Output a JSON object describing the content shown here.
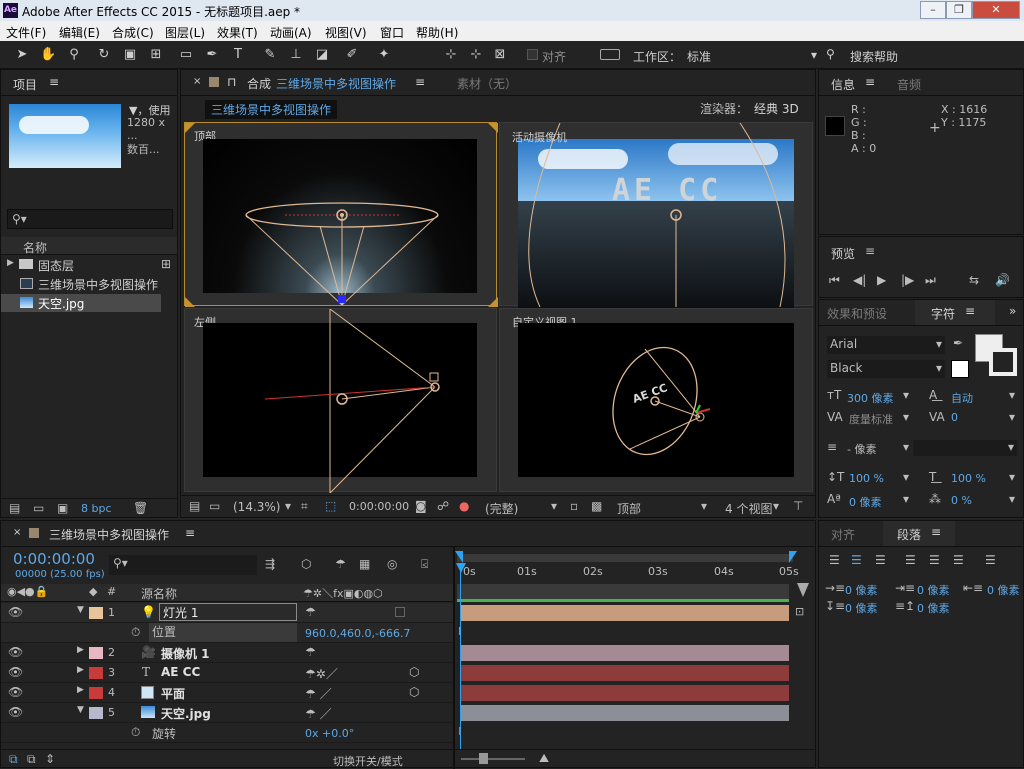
{
  "window": {
    "title": "Adobe After Effects CC 2015 - 无标题项目.aep *",
    "logo": "Ae",
    "min": "–",
    "max": "❐",
    "close": "✕"
  },
  "menu": [
    "文件(F)",
    "编辑(E)",
    "合成(C)",
    "图层(L)",
    "效果(T)",
    "动画(A)",
    "视图(V)",
    "窗口",
    "帮助(H)"
  ],
  "toolbar": {
    "align_label": "对齐",
    "workspace_label": "工作区：",
    "workspace_value": "标准",
    "search_help": "搜索帮助"
  },
  "project": {
    "tab": "项目",
    "footage_name": "▼，使用",
    "footage_dims": "1280 x ...",
    "footage_extra": "数百...",
    "search_icon": "search-icon",
    "col_name": "名称",
    "items": [
      {
        "label": "固态层",
        "type": "folder"
      },
      {
        "label": "三维场景中多视图操作",
        "type": "comp"
      },
      {
        "label": "天空.jpg",
        "type": "image"
      }
    ],
    "bpc": "8 bpc"
  },
  "composition": {
    "tab_prefix": "合成",
    "tab_name": "三维场景中多视图操作",
    "footage_tab": "素材（无）",
    "comp_label": "三维场景中多视图操作",
    "renderer_label": "渲染器：",
    "renderer_value": "经典 3D",
    "views": {
      "top": "顶部",
      "active": "活动摄像机",
      "left": "左侧",
      "custom": "自定义视图 1"
    },
    "footer": {
      "zoom": "(14.3%)",
      "timecode": "0:00:00:00",
      "quality": "(完整)",
      "view": "顶部",
      "layout": "4 个视图"
    }
  },
  "info": {
    "tab": "信息",
    "audio_tab": "音频",
    "r": "R :",
    "g": "G :",
    "b": "B :",
    "a": "A : 0",
    "x": "X : 1616",
    "y": "Y : 1175"
  },
  "preview": {
    "tab": "预览"
  },
  "character": {
    "effects_tab": "效果和预设",
    "tab": "字符",
    "font": "Arial",
    "style": "Black",
    "size": "300 像素",
    "leading": "自动",
    "tracking_label": "度量标准",
    "tracking_value": "0",
    "stroke": "- 像素",
    "vscale": "100 %",
    "hscale": "100 %",
    "baseline": "0 像素",
    "tsume": "0 %"
  },
  "paragraph": {
    "align_tab": "对齐",
    "tab": "段落",
    "indent_left": "0 像素",
    "indent_first": "0 像素",
    "indent_right": "0 像素",
    "space_before": "0 像素",
    "space_after": "0 像素"
  },
  "timeline": {
    "tab": "三维场景中多视图操作",
    "timecode": "0:00:00:00",
    "fps": "00000 (25.00 fps)",
    "col_source": "源名称",
    "col_num": "#",
    "ticks": [
      "0s",
      "01s",
      "02s",
      "03s",
      "04s",
      "05s"
    ],
    "footer_label": "切换开关/模式",
    "layers": [
      {
        "num": "1",
        "name": "灯光 1",
        "color": "#e8c49a",
        "bar": "#c69c7c",
        "prop": "位置",
        "prop_value": "960.0,460.0,-666.7"
      },
      {
        "num": "2",
        "name": "摄像机 1",
        "color": "#e7b7c4",
        "bar": "#a48a92"
      },
      {
        "num": "3",
        "name": "AE CC",
        "color": "#c83b3b",
        "bar": "#8e3b3b"
      },
      {
        "num": "4",
        "name": "平面",
        "color": "#c83b3b",
        "bar": "#8e3b3b"
      },
      {
        "num": "5",
        "name": "天空.jpg",
        "color": "#b8b8cc",
        "bar": "#8c8e98",
        "prop": "旋转",
        "prop_value": "0x +0.0°"
      }
    ]
  },
  "colors": {
    "accent": "#5fa8e6",
    "playhead": "#2ea3f2"
  }
}
